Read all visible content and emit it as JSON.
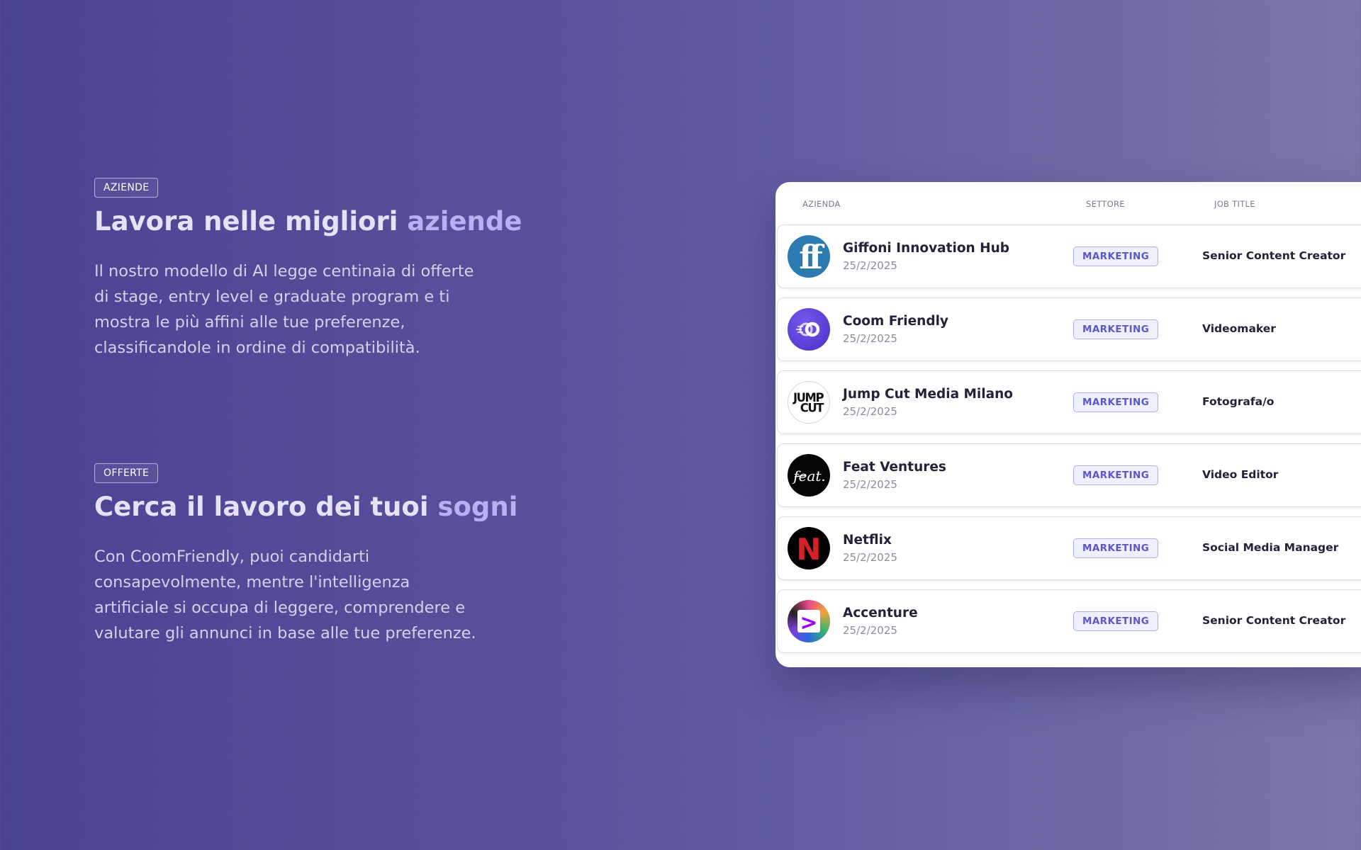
{
  "sections": [
    {
      "tag": "AZIENDE",
      "title_main": "Lavora nelle migliori ",
      "title_accent": "aziende",
      "description": "Il nostro modello di AI legge centinaia di offerte di stage, entry level e  graduate program e ti mostra le più affini alle tue preferenze, classificandole in ordine di compatibilità."
    },
    {
      "tag": "OFFERTE",
      "title_main": "Cerca il lavoro dei tuoi ",
      "title_accent": "sogni",
      "description": "Con CoomFriendly, puoi candidarti consapevolmente, mentre l'intelligenza artificiale si occupa di leggere, comprendere e valutare gli  annunci in base alle tue preferenze."
    }
  ],
  "table": {
    "headers": {
      "company": "AZIENDA",
      "sector": "SETTORE",
      "job": "JOB TITLE"
    },
    "rows": [
      {
        "company": "Giffoni Innovation Hub",
        "date": "25/2/2025",
        "sector": "MARKETING",
        "job": "Senior Content Creator",
        "logo": "giffoni-logo"
      },
      {
        "company": "Coom Friendly",
        "date": "25/2/2025",
        "sector": "MARKETING",
        "job": "Videomaker",
        "logo": "coomfriendly-logo"
      },
      {
        "company": "Jump Cut Media Milano",
        "date": "25/2/2025",
        "sector": "MARKETING",
        "job": "Fotografa/o",
        "logo": "jumpcut-logo"
      },
      {
        "company": "Feat Ventures",
        "date": "25/2/2025",
        "sector": "MARKETING",
        "job": "Video Editor",
        "logo": "feat-logo"
      },
      {
        "company": "Netflix",
        "date": "25/2/2025",
        "sector": "MARKETING",
        "job": "Social Media Manager",
        "logo": "netflix-logo"
      },
      {
        "company": "Accenture",
        "date": "25/2/2025",
        "sector": "MARKETING",
        "job": "Senior Content Creator",
        "logo": "accenture-logo"
      }
    ]
  },
  "logo_text": {
    "giffoni": "ff",
    "jumpcut_top": "JUMP",
    "jumpcut_bottom": "CUT",
    "feat": "feat.",
    "netflix": "N",
    "accenture": ">"
  },
  "colors": {
    "accent_text": "#b8b0f0",
    "badge_text": "#5a58c8",
    "badge_bg": "#eef0ff",
    "giffoni_blue": "#2b7ab0",
    "coom_purple": "#5a3fd6",
    "netflix_red": "#d81f26",
    "accenture_purple": "#a100ff"
  }
}
